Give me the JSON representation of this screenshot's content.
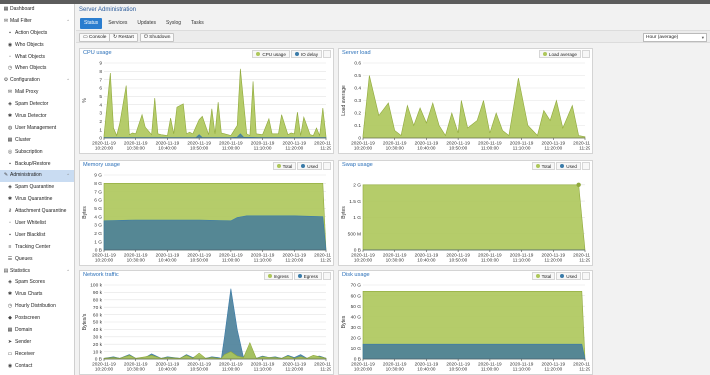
{
  "colors": {
    "green": "#adc75a",
    "green_dark": "#8fa83b",
    "blue": "#3a7ba8",
    "blue_fill": "#4a7f99",
    "accent": "#2a7dcf"
  },
  "sidebar": {
    "items": [
      {
        "label": "Dashboard",
        "icon": "dashboard-icon",
        "glyph": "▦",
        "level": 0
      },
      {
        "label": "Mail Filter",
        "icon": "envelope-icon",
        "glyph": "✉",
        "level": 0,
        "expanded": true
      },
      {
        "label": "Action Objects",
        "icon": "box-icon",
        "glyph": "▪",
        "level": 1
      },
      {
        "label": "Who Objects",
        "icon": "users-icon",
        "glyph": "◉",
        "level": 1
      },
      {
        "label": "What Objects",
        "icon": "file-icon",
        "glyph": "▫",
        "level": 1
      },
      {
        "label": "When Objects",
        "icon": "clock-icon",
        "glyph": "◷",
        "level": 1
      },
      {
        "label": "Configuration",
        "icon": "gear-icon",
        "glyph": "⚙",
        "level": 0,
        "expanded": true
      },
      {
        "label": "Mail Proxy",
        "icon": "mail-proxy-icon",
        "glyph": "✉",
        "level": 1
      },
      {
        "label": "Spam Detector",
        "icon": "bullhorn-icon",
        "glyph": "◈",
        "level": 1
      },
      {
        "label": "Virus Detector",
        "icon": "bug-icon",
        "glyph": "✱",
        "level": 1
      },
      {
        "label": "User Management",
        "icon": "user-icon",
        "glyph": "◍",
        "level": 1
      },
      {
        "label": "Cluster",
        "icon": "cluster-icon",
        "glyph": "▦",
        "level": 1
      },
      {
        "label": "Subscription",
        "icon": "support-icon",
        "glyph": "◎",
        "level": 1
      },
      {
        "label": "Backup/Restore",
        "icon": "floppy-icon",
        "glyph": "▪",
        "level": 1
      },
      {
        "label": "Administration",
        "icon": "wrench-icon",
        "glyph": "✎",
        "level": 0,
        "expanded": true
      },
      {
        "label": "Spam Quarantine",
        "icon": "spam-quarantine-icon",
        "glyph": "◈",
        "level": 1
      },
      {
        "label": "Virus Quarantine",
        "icon": "virus-quarantine-icon",
        "glyph": "✱",
        "level": 1
      },
      {
        "label": "Attachment Quarantine",
        "icon": "paperclip-icon",
        "glyph": "∂",
        "level": 1
      },
      {
        "label": "User Whitelist",
        "icon": "file-white-icon",
        "glyph": "▫",
        "level": 1
      },
      {
        "label": "User Blacklist",
        "icon": "file-black-icon",
        "glyph": "▪",
        "level": 1
      },
      {
        "label": "Tracking Center",
        "icon": "list-icon",
        "glyph": "≡",
        "level": 1
      },
      {
        "label": "Queues",
        "icon": "bars-icon",
        "glyph": "☰",
        "level": 1
      },
      {
        "label": "Statistics",
        "icon": "chart-icon",
        "glyph": "▤",
        "level": 0,
        "expanded": true
      },
      {
        "label": "Spam Scores",
        "icon": "bullhorn-icon",
        "glyph": "◈",
        "level": 1
      },
      {
        "label": "Virus Charts",
        "icon": "bug-icon",
        "glyph": "✱",
        "level": 1
      },
      {
        "label": "Hourly Distribution",
        "icon": "clock-icon",
        "glyph": "◷",
        "level": 1
      },
      {
        "label": "Postscreen",
        "icon": "shield-icon",
        "glyph": "◆",
        "level": 1
      },
      {
        "label": "Domain",
        "icon": "building-icon",
        "glyph": "▦",
        "level": 1
      },
      {
        "label": "Sender",
        "icon": "send-icon",
        "glyph": "➤",
        "level": 1
      },
      {
        "label": "Receiver",
        "icon": "inbox-icon",
        "glyph": "▭",
        "level": 1
      },
      {
        "label": "Contact",
        "icon": "contact-icon",
        "glyph": "◉",
        "level": 1
      }
    ],
    "active": "Administration"
  },
  "main": {
    "title": "Server Administration",
    "tabs": [
      "Status",
      "Services",
      "Updates",
      "Syslog",
      "Tasks"
    ],
    "active_tab": "Status",
    "toolbar": {
      "console": "Console",
      "restart": "Restart",
      "shutdown": "Shutdown"
    },
    "timeframe": "Hour (average)"
  },
  "chart_data": [
    {
      "id": "cpu",
      "title": "CPU usage",
      "type": "area",
      "ylabel": "%",
      "ylim": [
        0,
        9
      ],
      "yticks": [
        0,
        1,
        2,
        3,
        4,
        5,
        6,
        7,
        8,
        9
      ],
      "ytick_labels": [
        "0",
        "1",
        "2",
        "3",
        "4",
        "5",
        "6",
        "7",
        "8",
        "9"
      ],
      "xlim": [
        0,
        70
      ],
      "xticks": [
        0,
        10,
        20,
        30,
        40,
        50,
        60,
        70
      ],
      "xtick_labels": [
        "2020-11-19|10:20:00",
        "2020-11-19|10:30:00",
        "2020-11-19|10:40:00",
        "2020-11-19|10:50:00",
        "2020-11-19|11:00:00",
        "2020-11-19|11:10:00",
        "2020-11-19|11:20:00",
        "2020-11-19|11:29"
      ],
      "series": [
        {
          "name": "CPU usage",
          "color": "green",
          "x": [
            0,
            2,
            3,
            4,
            5,
            7,
            8,
            9,
            10,
            12,
            13,
            15,
            16,
            17,
            18,
            20,
            21,
            22,
            23,
            25,
            26,
            27,
            28,
            30,
            31,
            33,
            34,
            35,
            36,
            37,
            38,
            40,
            42,
            43,
            45,
            46,
            47,
            48,
            50,
            52,
            53,
            55,
            56,
            58,
            59,
            60,
            61,
            62,
            63,
            65,
            66,
            67,
            68,
            69,
            70
          ],
          "values": [
            0.3,
            7.8,
            1.2,
            0.3,
            1.8,
            6.3,
            0.4,
            0.6,
            0.5,
            2.8,
            1.3,
            0.4,
            4.8,
            0.5,
            0.4,
            0.3,
            2.4,
            0.5,
            3.7,
            4.1,
            0.5,
            0.7,
            0.5,
            2.2,
            2.6,
            0.4,
            3.5,
            0.5,
            4.3,
            0.6,
            0.5,
            0.3,
            1.5,
            8.3,
            0.5,
            0.3,
            6.8,
            0.5,
            0.4,
            2.3,
            0.5,
            0.5,
            2.8,
            0.4,
            0.6,
            0.5,
            3.1,
            0.3,
            2.5,
            0.4,
            0.3,
            1.2,
            0.3,
            3.6,
            0.2
          ]
        },
        {
          "name": "IO delay",
          "color": "blue",
          "x": [
            0,
            10,
            20,
            29,
            30,
            31,
            40,
            42,
            43,
            44,
            50,
            60,
            70
          ],
          "values": [
            0.05,
            0.05,
            0.05,
            0.05,
            0.4,
            0.05,
            0.05,
            0.1,
            0.5,
            0.1,
            0.05,
            0.05,
            0.05
          ]
        }
      ]
    },
    {
      "id": "load",
      "title": "Server load",
      "type": "area",
      "ylabel": "Load average",
      "ylim": [
        0,
        0.6
      ],
      "yticks": [
        0,
        0.1,
        0.2,
        0.3,
        0.4,
        0.5,
        0.6
      ],
      "ytick_labels": [
        "0",
        "0.1",
        "0.2",
        "0.3",
        "0.4",
        "0.5",
        "0.6"
      ],
      "xlim": [
        0,
        70
      ],
      "xticks": [
        0,
        10,
        20,
        30,
        40,
        50,
        60,
        70
      ],
      "xtick_labels": [
        "2020-11-19|10:20:00",
        "2020-11-19|10:30:00",
        "2020-11-19|10:40:00",
        "2020-11-19|10:50:00",
        "2020-11-19|11:00:00",
        "2020-11-19|11:10:00",
        "2020-11-19|11:20:00",
        "2020-11-19|11:29"
      ],
      "series": [
        {
          "name": "Load average",
          "color": "green",
          "x": [
            0,
            2,
            5,
            8,
            10,
            12,
            14,
            16,
            18,
            20,
            22,
            24,
            26,
            28,
            30,
            31,
            33,
            36,
            38,
            40,
            42,
            44,
            46,
            49,
            52,
            55,
            57,
            59,
            61,
            63,
            66,
            68,
            70
          ],
          "values": [
            0.02,
            0.5,
            0.18,
            0.28,
            0.06,
            0.02,
            0.26,
            0.1,
            0.24,
            0.12,
            0.28,
            0.1,
            0.02,
            0.2,
            0.04,
            0.3,
            0.08,
            0.14,
            0.3,
            0.04,
            0.2,
            0.06,
            0.02,
            0.48,
            0.1,
            0.02,
            0.22,
            0.14,
            0.3,
            0.08,
            0.26,
            0.02,
            0.01
          ]
        }
      ]
    },
    {
      "id": "memory",
      "title": "Memory usage",
      "type": "area",
      "ylabel": "Bytes",
      "ylim": [
        0,
        9
      ],
      "yticks": [
        0,
        1,
        2,
        3,
        4,
        5,
        6,
        7,
        8,
        9
      ],
      "ytick_labels": [
        "0 B",
        "1 G",
        "2 G",
        "3 G",
        "4 G",
        "5 G",
        "6 G",
        "7 G",
        "8 G",
        "9 G"
      ],
      "xlim": [
        0,
        70
      ],
      "xticks": [
        0,
        10,
        20,
        30,
        40,
        50,
        60,
        70
      ],
      "xtick_labels": [
        "2020-11-19|10:20:00",
        "2020-11-19|10:30:00",
        "2020-11-19|10:40:00",
        "2020-11-19|10:50:00",
        "2020-11-19|11:00:00",
        "2020-11-19|11:10:00",
        "2020-11-19|11:20:00",
        "2020-11-19|11:29"
      ],
      "series": [
        {
          "name": "Total",
          "color": "green",
          "x": [
            0,
            69,
            70
          ],
          "values": [
            8.0,
            8.0,
            0
          ]
        },
        {
          "name": "Used",
          "color": "blue",
          "x": [
            0,
            10,
            20,
            30,
            40,
            42,
            45,
            50,
            60,
            69,
            70
          ],
          "values": [
            3.5,
            3.6,
            3.6,
            3.6,
            3.5,
            3.9,
            4.1,
            4.1,
            4.1,
            4.0,
            0
          ]
        }
      ]
    },
    {
      "id": "swap",
      "title": "Swap usage",
      "type": "area",
      "ylabel": "Bytes",
      "ylim": [
        0,
        2.3
      ],
      "yticks": [
        0,
        0.5,
        1,
        1.5,
        2
      ],
      "ytick_labels": [
        "0 B",
        "500 M",
        "1 G",
        "1.5 G",
        "2 G"
      ],
      "xlim": [
        0,
        70
      ],
      "xticks": [
        0,
        10,
        20,
        30,
        40,
        50,
        60,
        70
      ],
      "xtick_labels": [
        "2020-11-19|10:20:00",
        "2020-11-19|10:30:00",
        "2020-11-19|10:40:00",
        "2020-11-19|10:50:00",
        "2020-11-19|11:00:00",
        "2020-11-19|11:10:00",
        "2020-11-19|11:20:00",
        "2020-11-19|11:29"
      ],
      "series": [
        {
          "name": "Total",
          "color": "green",
          "x": [
            0,
            68,
            70
          ],
          "values": [
            2.0,
            2.0,
            0
          ]
        },
        {
          "name": "Used",
          "color": "blue",
          "x": [
            0,
            70
          ],
          "values": [
            0,
            0
          ]
        }
      ]
    },
    {
      "id": "net",
      "title": "Network traffic",
      "type": "area",
      "ylabel": "Bytes/s",
      "ylim": [
        0,
        100
      ],
      "yticks": [
        0,
        10,
        20,
        30,
        40,
        50,
        60,
        70,
        80,
        90,
        100
      ],
      "ytick_labels": [
        "0 B",
        "10 k",
        "20 k",
        "30 k",
        "40 k",
        "50 k",
        "60 k",
        "70 k",
        "80 k",
        "90 k",
        "100 k"
      ],
      "xlim": [
        0,
        70
      ],
      "xticks": [
        0,
        10,
        20,
        30,
        40,
        50,
        60,
        70
      ],
      "xtick_labels": [
        "2020-11-19|10:20:00",
        "2020-11-19|10:30:00",
        "2020-11-19|10:40:00",
        "2020-11-19|10:50:00",
        "2020-11-19|11:00:00",
        "2020-11-19|11:10:00",
        "2020-11-19|11:20:00",
        "2020-11-19|11:29"
      ],
      "series": [
        {
          "name": "Egress",
          "color": "blue",
          "x": [
            0,
            3,
            5,
            8,
            10,
            13,
            15,
            18,
            20,
            24,
            26,
            28,
            30,
            32,
            34,
            36,
            37,
            38,
            40,
            42,
            44,
            46,
            48,
            50,
            52,
            54,
            56,
            58,
            60,
            62,
            64,
            66,
            68,
            70
          ],
          "values": [
            1,
            3,
            1,
            6,
            1,
            2,
            7,
            1,
            3,
            1,
            6,
            2,
            5,
            1,
            3,
            2,
            1,
            30,
            95,
            40,
            2,
            18,
            1,
            4,
            2,
            3,
            1,
            5,
            2,
            6,
            1,
            3,
            4,
            1
          ]
        },
        {
          "name": "Ingress",
          "color": "green",
          "x": [
            0,
            3,
            5,
            8,
            10,
            13,
            15,
            18,
            20,
            24,
            26,
            28,
            30,
            32,
            34,
            36,
            37,
            38,
            40,
            42,
            44,
            46,
            48,
            50,
            52,
            54,
            56,
            58,
            60,
            62,
            64,
            66,
            68,
            70
          ],
          "values": [
            1,
            2,
            1,
            5,
            1,
            3,
            5,
            1,
            2,
            1,
            5,
            1,
            8,
            1,
            2,
            1,
            1,
            6,
            10,
            4,
            2,
            22,
            1,
            3,
            2,
            2,
            1,
            4,
            1,
            3,
            1,
            5,
            3,
            1
          ]
        }
      ]
    },
    {
      "id": "disk",
      "title": "Disk usage",
      "type": "area",
      "ylabel": "Bytes",
      "ylim": [
        0,
        70
      ],
      "yticks": [
        0,
        10,
        20,
        30,
        40,
        50,
        60,
        70
      ],
      "ytick_labels": [
        "0 B",
        "10 G",
        "20 G",
        "30 G",
        "40 G",
        "50 G",
        "60 G",
        "70 G"
      ],
      "xlim": [
        0,
        70
      ],
      "xticks": [
        0,
        10,
        20,
        30,
        40,
        50,
        60,
        70
      ],
      "xtick_labels": [
        "2020-11-19|10:20:00",
        "2020-11-19|10:30:00",
        "2020-11-19|10:40:00",
        "2020-11-19|10:50:00",
        "2020-11-19|11:00:00",
        "2020-11-19|11:10:00",
        "2020-11-19|11:20:00",
        "2020-11-19|11:29"
      ],
      "series": [
        {
          "name": "Total",
          "color": "green",
          "x": [
            0,
            69,
            70
          ],
          "values": [
            64,
            64,
            0
          ]
        },
        {
          "name": "Used",
          "color": "blue",
          "x": [
            0,
            69,
            70
          ],
          "values": [
            14,
            14,
            0
          ]
        }
      ]
    }
  ]
}
